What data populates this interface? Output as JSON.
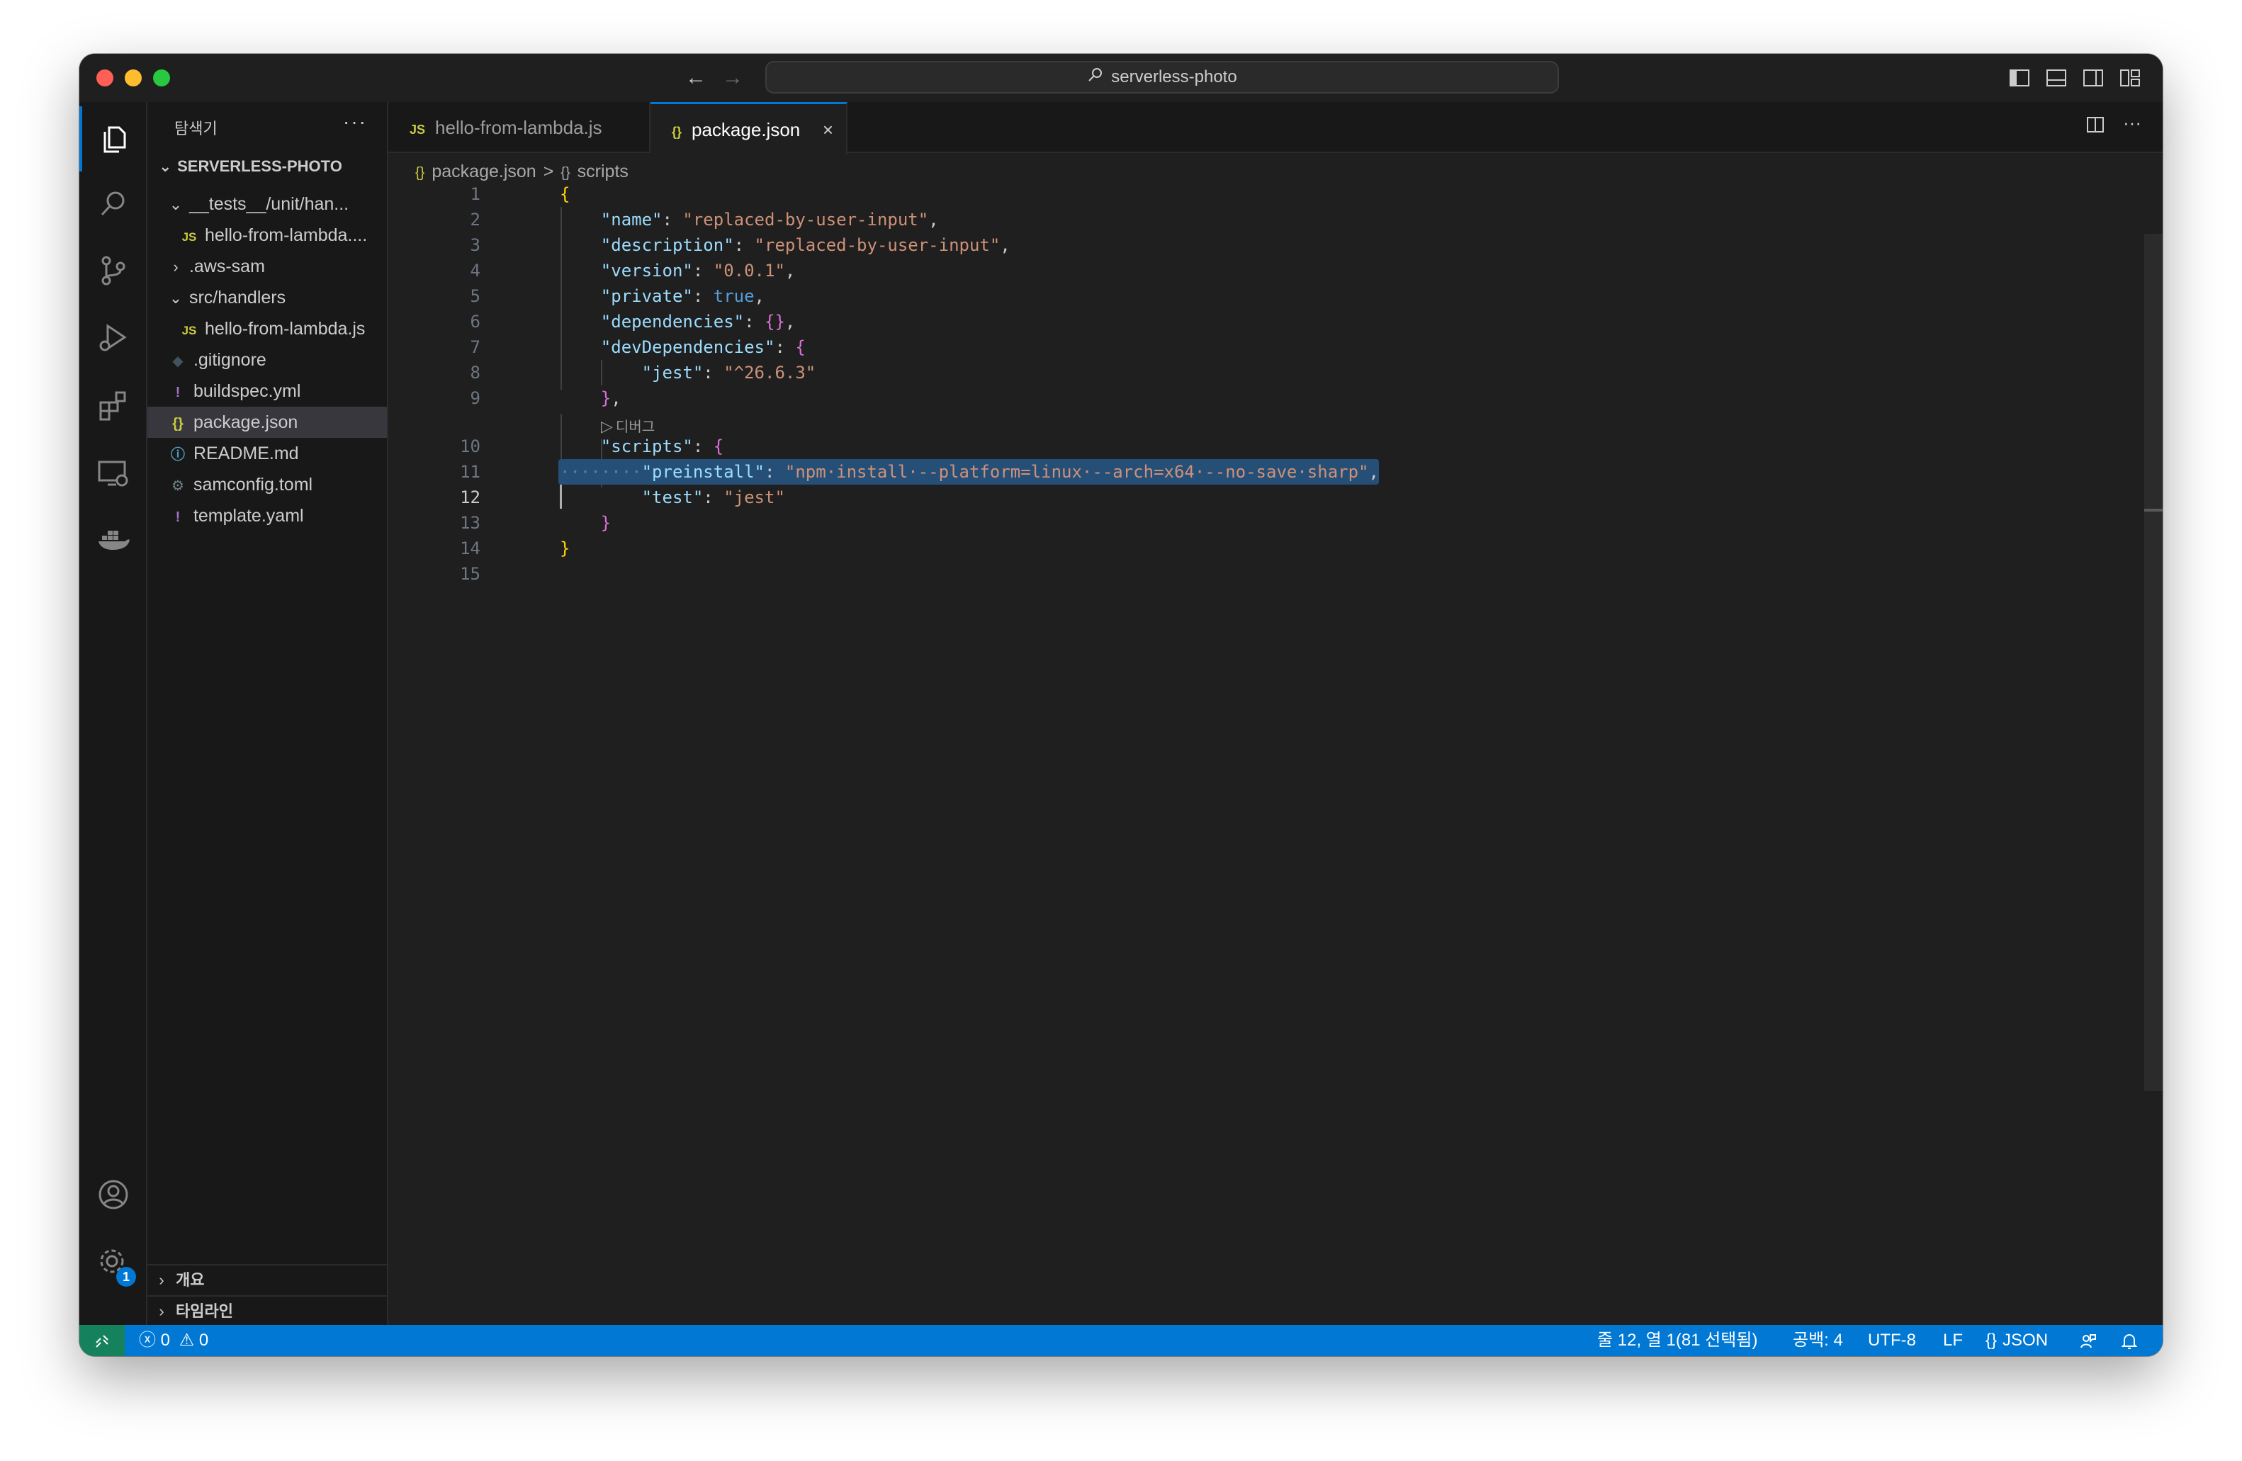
{
  "titlebar": {
    "search_text": "serverless-photo",
    "back_icon": "arrow-left-icon",
    "forward_icon": "arrow-right-icon"
  },
  "sidebar": {
    "title": "탐색기",
    "more": "···",
    "section": "SERVERLESS-PHOTO",
    "tree": [
      {
        "label": "__tests__/unit/han...",
        "kind": "folder-open",
        "icon": ""
      },
      {
        "label": "hello-from-lambda....",
        "kind": "file",
        "icon": "JS"
      },
      {
        "label": ".aws-sam",
        "kind": "folder-closed",
        "icon": ""
      },
      {
        "label": "src/handlers",
        "kind": "folder-open",
        "icon": ""
      },
      {
        "label": "hello-from-lambda.js",
        "kind": "file",
        "icon": "JS"
      },
      {
        "label": ".gitignore",
        "kind": "file",
        "icon": "◆"
      },
      {
        "label": "buildspec.yml",
        "kind": "file",
        "icon": "!"
      },
      {
        "label": "package.json",
        "kind": "file",
        "icon": "{}"
      },
      {
        "label": "README.md",
        "kind": "file",
        "icon": "ⓘ"
      },
      {
        "label": "samconfig.toml",
        "kind": "file",
        "icon": "⚙"
      },
      {
        "label": "template.yaml",
        "kind": "file",
        "icon": "!"
      }
    ],
    "outline": "개요",
    "timeline": "타임라인"
  },
  "activity": {
    "settings_badge": "1"
  },
  "tabs": [
    {
      "label": "hello-from-lambda.js",
      "icon": "JS",
      "active": false
    },
    {
      "label": "package.json",
      "icon": "{}",
      "active": true,
      "close": "×"
    }
  ],
  "breadcrumb": {
    "file_icon": "{}",
    "file": "package.json",
    "sep": ">",
    "symbol_icon": "{}",
    "symbol": "scripts"
  },
  "editor": {
    "codelens": "디버그",
    "line_numbers": [
      "1",
      "2",
      "3",
      "4",
      "5",
      "6",
      "7",
      "8",
      "9",
      "10",
      "11",
      "12",
      "13",
      "14",
      "15"
    ],
    "current_line": "12"
  },
  "statusbar": {
    "errors": "0",
    "warnings": "0",
    "position": "줄 12, 열 1(81 선택됨)",
    "indent": "공백: 4",
    "encoding": "UTF-8",
    "eol": "LF",
    "language_icon": "{}",
    "language": "JSON"
  },
  "colors": {
    "accent": "#0078d4",
    "selection": "#264f78",
    "remote": "#16825d"
  }
}
